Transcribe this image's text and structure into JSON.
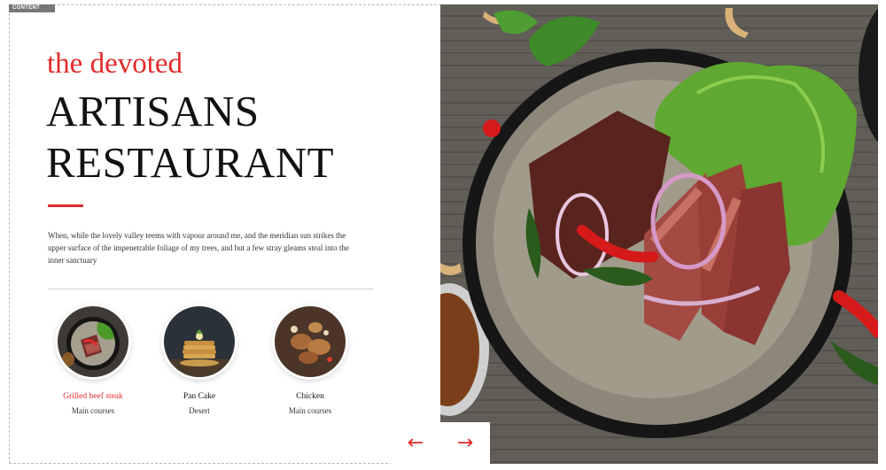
{
  "frame": {
    "tag_label": "CONTENT"
  },
  "hero": {
    "tagline": "the devoted",
    "title_line1": "ARTISANS",
    "title_line2": "RESTAURANT",
    "intro": "When, while the lovely valley teems with vapour around me, and the meridian sun strikes the upper surface of the impenetrable foliage of my trees, and but a few stray gleams steal into the inner sanctuary"
  },
  "dishes": [
    {
      "name": "Grilled beef steak",
      "category": "Main courses",
      "active": true
    },
    {
      "name": "Pan Cake",
      "category": "Desert",
      "active": false
    },
    {
      "name": "Chicken",
      "category": "Main courses",
      "active": false
    }
  ],
  "colors": {
    "accent": "#e32a2a",
    "text": "#111111"
  },
  "navigation": {
    "prev_icon": "arrow-left-icon",
    "next_icon": "arrow-right-icon"
  }
}
